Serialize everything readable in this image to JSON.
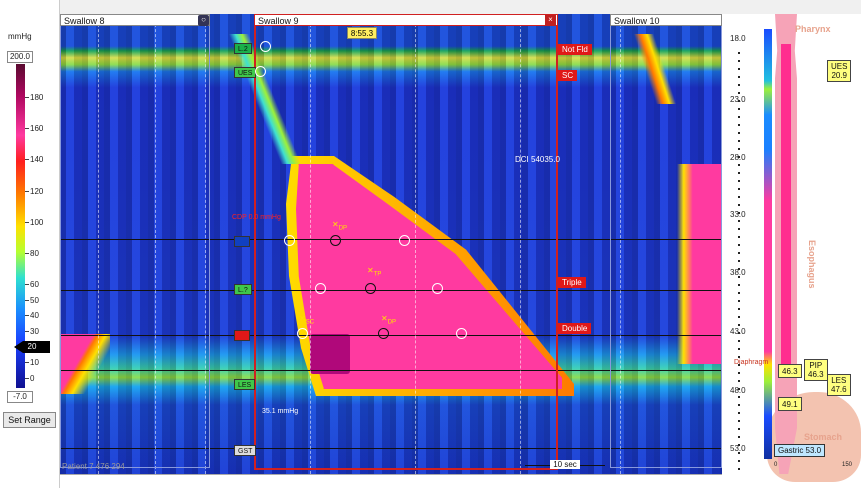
{
  "scale": {
    "unit": "mmHg",
    "max": "200.0",
    "min": "-7.0",
    "ticks": [
      "180",
      "160",
      "140",
      "120",
      "100",
      "80",
      "60",
      "50",
      "40",
      "30",
      "20",
      "10",
      "0"
    ],
    "threshold": "20",
    "set_range_label": "Set Range"
  },
  "swallows": {
    "s8": "Swallow 8",
    "s9": "Swallow 9",
    "s10": "Swallow 10"
  },
  "plot": {
    "time_marker": "8:55.3",
    "dci": "DCI 54035.0",
    "contour_label": "35.1 mmHg",
    "cdp_label": "CDP 0.0 mmHg",
    "patient": "Patient 7 476 294",
    "ten_sec": "10 sec",
    "tags": {
      "not_fld": "Not Fld",
      "sc": "SC",
      "triple": "Triple",
      "double": "Double"
    },
    "markers": {
      "p1": "L.2",
      "p2": "UES",
      "p3": "LES",
      "p4": "GST",
      "p5": "L.?"
    },
    "points": {
      "dp": "DP",
      "tp": "TP",
      "sc": "SC",
      "dp2": "DP"
    }
  },
  "anatomy": {
    "pharynx": "Pharynx",
    "esophagus": "Esophagus",
    "stomach": "Stomach",
    "diaphragm": "Diaphragm",
    "ruler": [
      "18.0",
      "23.0",
      "28.0",
      "33.0",
      "38.0",
      "43.0",
      "48.0",
      "53.0"
    ],
    "ues": {
      "label": "UES",
      "value": "20.9"
    },
    "pip_value": "46.3",
    "pip": {
      "label": "PIP",
      "value": "46.3"
    },
    "les": {
      "label": "LES",
      "value": "47.6"
    },
    "v491": "49.1",
    "gastric": "Gastric 53.0",
    "axis_min": "0",
    "axis_max": "150"
  }
}
